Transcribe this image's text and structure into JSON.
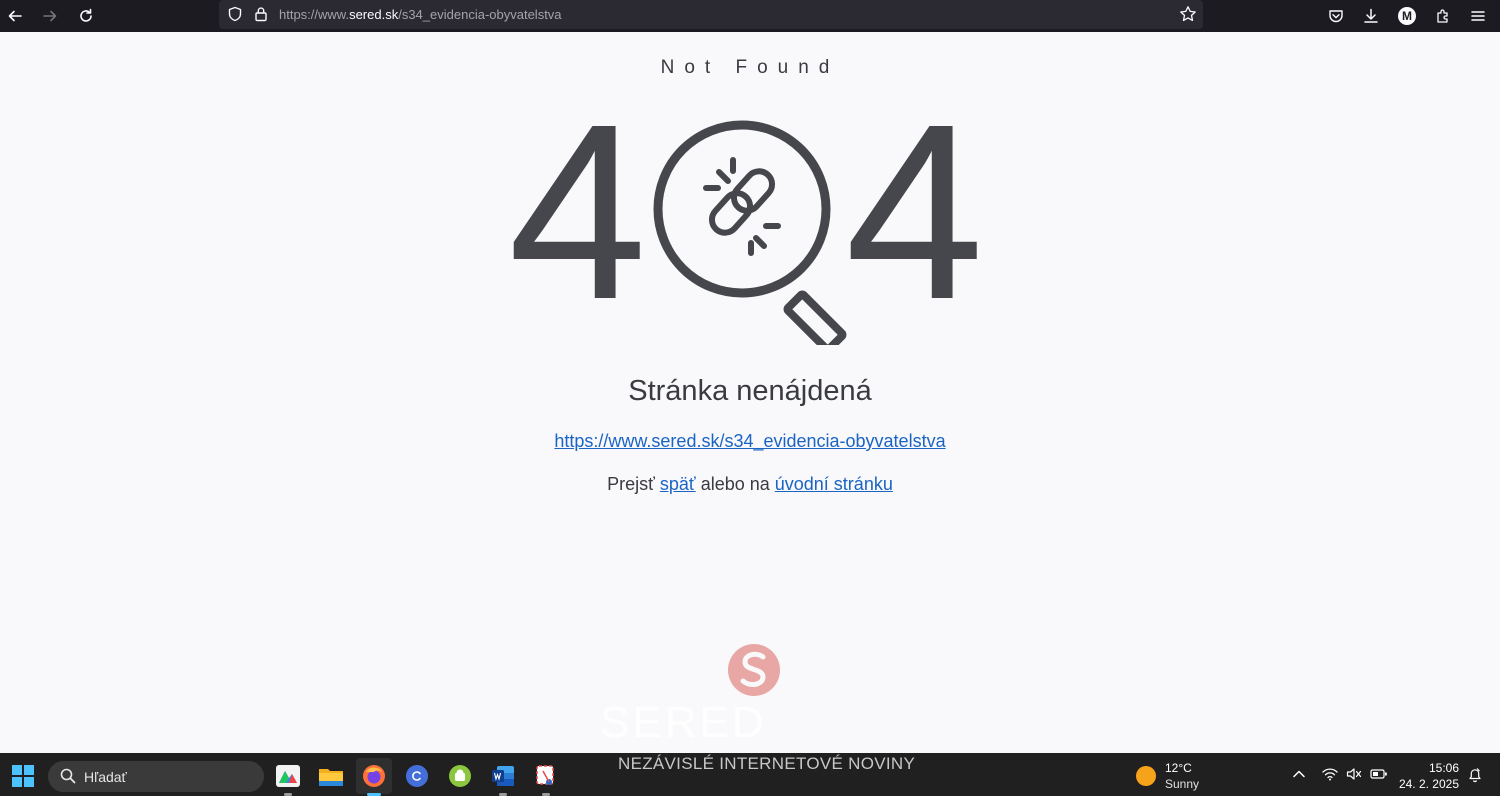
{
  "browser": {
    "url_host": "https://www.",
    "url_domain": "sered.sk",
    "url_path": "/s34_evidencia-obyvatelstva",
    "profile_initial": "M",
    "icons": [
      "back-arrow-icon",
      "forward-arrow-icon",
      "reload-icon",
      "shield-icon",
      "lock-icon",
      "star-icon",
      "pocket-icon",
      "download-icon",
      "extensions-icon",
      "menu-icon"
    ]
  },
  "page": {
    "not_found_label": "Not Found",
    "error_code_left": "4",
    "error_code_right": "4",
    "heading": "Stránka nenájdená",
    "requested_url": "https://www.sered.sk/s34_evidencia-obyvatelstva",
    "nav_prefix": "Prejsť ",
    "nav_back_link": "späť",
    "nav_middle": " alebo na ",
    "nav_home_link": "úvodní stránku",
    "logo_word": "SERED",
    "logo_color": "#e8a7a4",
    "text_color": "#3a3b40",
    "link_color": "#1a64c4"
  },
  "taskbar": {
    "search_label": "Hľadať",
    "news_banner": "NEZÁVISLÉ INTERNETOVÉ NOVINY",
    "weather_temp": "12°C",
    "weather_cond": "Sunny",
    "time": "15:06",
    "date": "24. 2. 2025",
    "apps": [
      "maps-app-icon",
      "file-explorer-icon",
      "firefox-icon",
      "canva-icon",
      "android-app-icon",
      "word-icon",
      "snipping-tool-icon"
    ]
  }
}
